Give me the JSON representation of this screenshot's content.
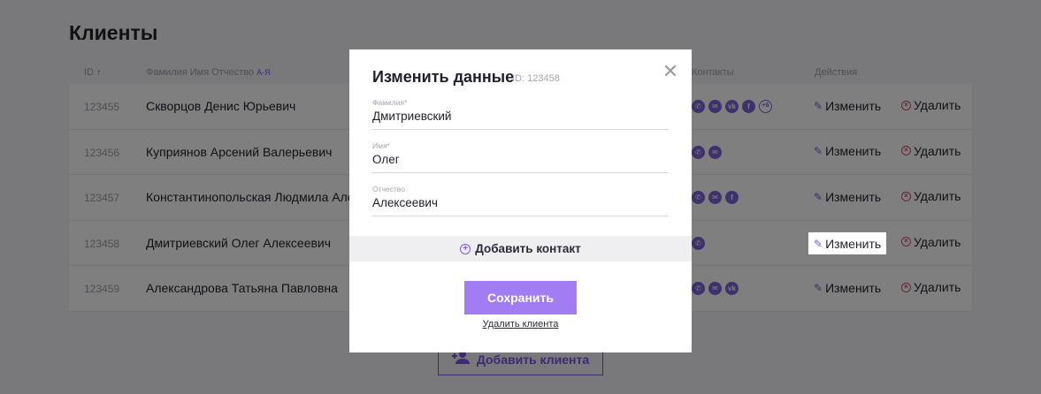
{
  "page": {
    "title": "Клиенты"
  },
  "table": {
    "headers": {
      "id": "ID",
      "name": "Фамилия Имя Отчество",
      "name_sort": "А-Я",
      "contacts": "Контакты",
      "actions": "Действия"
    },
    "rows": [
      {
        "id": "123455",
        "name": "Скворцов Денис Юрьевич",
        "contacts": [
          "phone",
          "mail",
          "vk",
          "fb",
          "+6"
        ]
      },
      {
        "id": "123456",
        "name": "Куприянов Арсений Валерьевич",
        "contacts": [
          "phone",
          "mail"
        ]
      },
      {
        "id": "123457",
        "name": "Константинопольская Людмила Алекс",
        "contacts": [
          "phone",
          "mail",
          "fb"
        ]
      },
      {
        "id": "123458",
        "name": "Дмитриевский Олег Алексеевич",
        "contacts": [
          "phone"
        ]
      },
      {
        "id": "123459",
        "name": "Александрова Татьяна Павловна",
        "contacts": [
          "phone",
          "mail",
          "vk"
        ]
      }
    ],
    "edit_label": "Изменить",
    "delete_label": "Удалить"
  },
  "add_client_label": "Добавить клиента",
  "modal": {
    "title": "Изменить данные",
    "id_label": "ID: 123458",
    "fields": {
      "surname_label": "Фамилия*",
      "surname_value": "Дмитриевский",
      "name_label": "Имя*",
      "name_value": "Олег",
      "patronymic_label": "Отчество",
      "patronymic_value": "Алексеевич"
    },
    "add_contact_label": "Добавить контакт",
    "save_label": "Сохранить",
    "delete_client_label": "Удалить клиента"
  },
  "colors": {
    "accent": "#7c55e6",
    "save_button": "#a17cf3",
    "delete": "#e0485e"
  }
}
